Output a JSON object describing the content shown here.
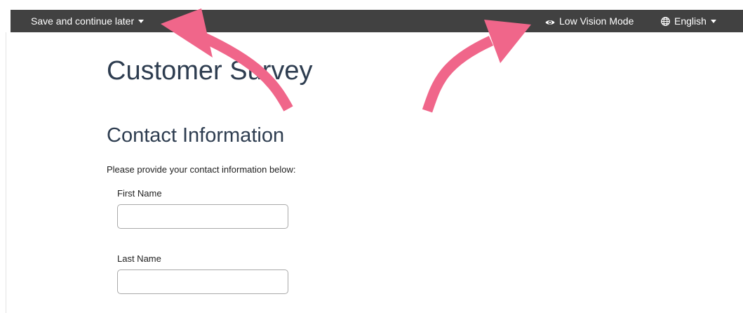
{
  "topbar": {
    "save_label": "Save and continue later",
    "low_vision_label": "Low Vision Mode",
    "language_label": "English"
  },
  "survey": {
    "title": "Customer Survey",
    "section_heading": "Contact Information",
    "instructions": "Please provide your contact information below:",
    "fields": [
      {
        "label": "First Name",
        "value": ""
      },
      {
        "label": "Last Name",
        "value": ""
      }
    ]
  },
  "icons": {
    "save_menu": "chevron-down-icon",
    "low_vision": "eye-icon",
    "language": "globe-icon",
    "language_menu": "chevron-down-icon"
  },
  "colors": {
    "topbar_background": "#414141",
    "heading_text": "#2e3d50",
    "annotation_arrow": "#f0668a"
  }
}
